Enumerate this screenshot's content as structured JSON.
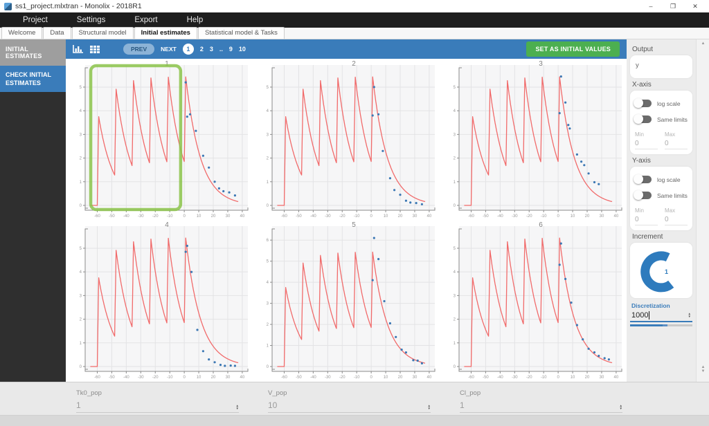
{
  "window": {
    "title": "ss1_project.mlxtran - Monolix - 2018R1",
    "controls": {
      "minimize": "–",
      "maximize": "❐",
      "close": "✕"
    }
  },
  "menu": {
    "items": [
      "Project",
      "Settings",
      "Export",
      "Help"
    ]
  },
  "tabs": {
    "items": [
      {
        "label": "Welcome"
      },
      {
        "label": "Data"
      },
      {
        "label": "Structural model"
      },
      {
        "label": "Initial estimates"
      },
      {
        "label": "Statistical model & Tasks"
      }
    ],
    "active_index": 3
  },
  "sidebar": {
    "header": "INITIAL ESTIMATES",
    "active_item": "CHECK INITIAL ESTIMATES"
  },
  "toolbar": {
    "prev_label": "PREV",
    "next_label": "NEXT",
    "pages": [
      "1",
      "2",
      "3",
      "..",
      "9",
      "10"
    ],
    "current_page": "1",
    "set_button_label": "SET AS INITIAL VALUES"
  },
  "right_panel": {
    "output": {
      "label": "Output",
      "value": "y"
    },
    "x_axis": {
      "label": "X-axis",
      "log_scale_label": "log scale",
      "same_limits_label": "Same limits",
      "min_label": "Min",
      "max_label": "Max",
      "min_value": "0",
      "max_value": "0"
    },
    "y_axis": {
      "label": "Y-axis",
      "log_scale_label": "log scale",
      "same_limits_label": "Same limits",
      "min_label": "Min",
      "max_label": "Max",
      "min_value": "0",
      "max_value": "0"
    },
    "increment": {
      "label": "Increment",
      "value": "1"
    },
    "discretization": {
      "label": "Discretization",
      "value": "1000"
    }
  },
  "bottom": {
    "params": [
      {
        "name": "Tk0_pop",
        "value": "1"
      },
      {
        "name": "V_pop",
        "value": "10"
      },
      {
        "name": "Cl_pop",
        "value": "1"
      }
    ]
  },
  "colors": {
    "accent_blue": "#3a7cba",
    "button_green": "#4caf50",
    "highlight_green": "#8bc34a",
    "curve_red": "#f16a6a",
    "dot_blue": "#3c78b4"
  },
  "chart_data": {
    "type": "line",
    "xlim": [
      -65,
      41
    ],
    "x_ticks": [
      -60,
      -50,
      -40,
      -30,
      -20,
      -10,
      0,
      10,
      20,
      30,
      40
    ],
    "curve_color": "#f16a6a",
    "dot_color": "#3c78b4",
    "curve_model": {
      "description": "steady-state repeated dosing: zero-order absorption then first-order elimination",
      "doses_at": [
        -60,
        -48,
        -36,
        -24,
        -12,
        0
      ],
      "interdose_interval": 12,
      "absorption_duration": 1,
      "elimination_rate": 0.0975,
      "single_dose_cmax": 3.75,
      "t_end": 37.4
    },
    "subplots": [
      {
        "title": "1",
        "ylim": [
          0,
          5.7
        ],
        "yticks": [
          0,
          1,
          2,
          3,
          4,
          5
        ],
        "points": [
          [
            1,
            5.2
          ],
          [
            2,
            3.75
          ],
          [
            4,
            3.85
          ],
          [
            8,
            3.15
          ],
          [
            13,
            2.1
          ],
          [
            17,
            1.6
          ],
          [
            21,
            1.0
          ],
          [
            24,
            0.72
          ],
          [
            27,
            0.6
          ],
          [
            31,
            0.55
          ],
          [
            35,
            0.42
          ]
        ],
        "highlight": {
          "x0": -64.5,
          "x1": -2.5
        }
      },
      {
        "title": "2",
        "ylim": [
          0,
          5.7
        ],
        "yticks": [
          0,
          1,
          2,
          3,
          4,
          5
        ],
        "points": [
          [
            1,
            3.8
          ],
          [
            2,
            5.0
          ],
          [
            5,
            3.85
          ],
          [
            8,
            2.3
          ],
          [
            13,
            1.15
          ],
          [
            16,
            0.65
          ],
          [
            20,
            0.45
          ],
          [
            24,
            0.2
          ],
          [
            27,
            0.12
          ],
          [
            31,
            0.1
          ],
          [
            35,
            0.05
          ]
        ]
      },
      {
        "title": "3",
        "ylim": [
          0,
          5.7
        ],
        "yticks": [
          0,
          1,
          2,
          3,
          4,
          5
        ],
        "points": [
          [
            1,
            3.9
          ],
          [
            2,
            5.45
          ],
          [
            5,
            4.35
          ],
          [
            7,
            3.4
          ],
          [
            8,
            3.25
          ],
          [
            13,
            2.15
          ],
          [
            16,
            1.85
          ],
          [
            18,
            1.7
          ],
          [
            21,
            1.35
          ],
          [
            25,
            0.98
          ],
          [
            28,
            0.9
          ]
        ]
      },
      {
        "title": "4",
        "ylim": [
          0,
          5.7
        ],
        "yticks": [
          0,
          1,
          2,
          3,
          4,
          5
        ],
        "points": [
          [
            1,
            4.85
          ],
          [
            2,
            5.1
          ],
          [
            5,
            4.0
          ],
          [
            9,
            1.55
          ],
          [
            13,
            0.65
          ],
          [
            17,
            0.3
          ],
          [
            21,
            0.18
          ],
          [
            25,
            0.07
          ],
          [
            28,
            0.03
          ],
          [
            32,
            0.04
          ],
          [
            35,
            0.03
          ]
        ]
      },
      {
        "title": "5",
        "ylim": [
          0,
          6.4
        ],
        "yticks": [
          0,
          1,
          2,
          3,
          4,
          5,
          6
        ],
        "points": [
          [
            1,
            4.1
          ],
          [
            2,
            6.1
          ],
          [
            5,
            5.1
          ],
          [
            9,
            3.1
          ],
          [
            13,
            2.05
          ],
          [
            17,
            1.4
          ],
          [
            21,
            0.8
          ],
          [
            24,
            0.67
          ],
          [
            29,
            0.3
          ],
          [
            32,
            0.28
          ],
          [
            35,
            0.15
          ]
        ]
      },
      {
        "title": "6",
        "ylim": [
          0,
          5.7
        ],
        "yticks": [
          0,
          1,
          2,
          3,
          4,
          5
        ],
        "points": [
          [
            1,
            4.3
          ],
          [
            2,
            5.2
          ],
          [
            5,
            3.7
          ],
          [
            9,
            2.7
          ],
          [
            13,
            1.75
          ],
          [
            17,
            1.15
          ],
          [
            21,
            0.75
          ],
          [
            25,
            0.6
          ],
          [
            28,
            0.45
          ],
          [
            32,
            0.35
          ],
          [
            35,
            0.3
          ]
        ]
      }
    ]
  }
}
